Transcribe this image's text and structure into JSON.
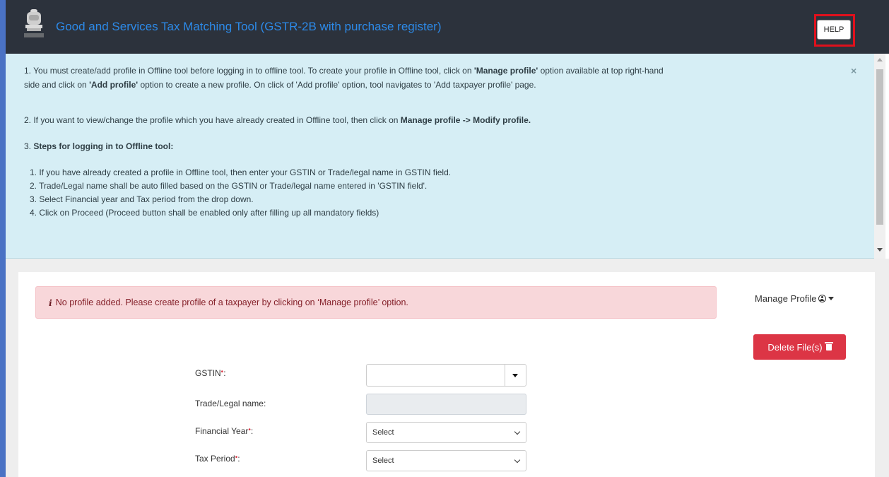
{
  "header": {
    "title": "Good and Services Tax Matching Tool (GSTR-2B with purchase register)",
    "help_label": "HELP",
    "emblem_text": "सत्यमेव जयते"
  },
  "info_panel": {
    "close_label": "×",
    "p1_a": "1. You must create/add profile in Offline tool before logging in to offline tool. To create your profile in Offline tool, click on ",
    "p1_b": "'Manage profile'",
    "p1_c": " option available at top right-hand",
    "p1_d": "side and click on ",
    "p1_e": "'Add profile'",
    "p1_f": " option to create a new profile. On click of 'Add profile' option, tool navigates to 'Add taxpayer profile' page.",
    "p2_a": "2. If you want to view/change the profile which you have already created in Offline tool, then click on ",
    "p2_b": "Manage profile -> Modify profile.",
    "p3_a": "3. ",
    "p3_b": "Steps for logging in to Offline tool:",
    "steps": [
      "1. If you have already created a profile in Offline tool, then enter your GSTIN or Trade/legal name in GSTIN field.",
      "2. Trade/Legal name shall be auto filled based on the GSTIN or Trade/legal name entered in 'GSTIN field'.",
      "3. Select Financial year and Tax period from the drop down.",
      "4. Click on Proceed (Proceed button shall be enabled only after filling up all mandatory fields)"
    ]
  },
  "alert": {
    "icon": "info-icon",
    "text": "No profile added. Please create profile of a taxpayer by clicking on ‘Manage profile’ option."
  },
  "manage_profile_label": "Manage Profile",
  "delete_label": "Delete File(s)",
  "form": {
    "gstin_label": "GSTIN",
    "gstin_value": "",
    "trade_label": "Trade/Legal name:",
    "fy_label": "Financial Year",
    "fy_value": "Select",
    "tp_label": "Tax Period",
    "tp_value": "Select",
    "required_mark": "•",
    "colon": ":"
  },
  "colors": {
    "header_bg": "#2c323c",
    "title_color": "#2d8ae8",
    "info_bg": "#d6eef5",
    "alert_bg": "#f8d7da",
    "danger": "#dc3545"
  }
}
